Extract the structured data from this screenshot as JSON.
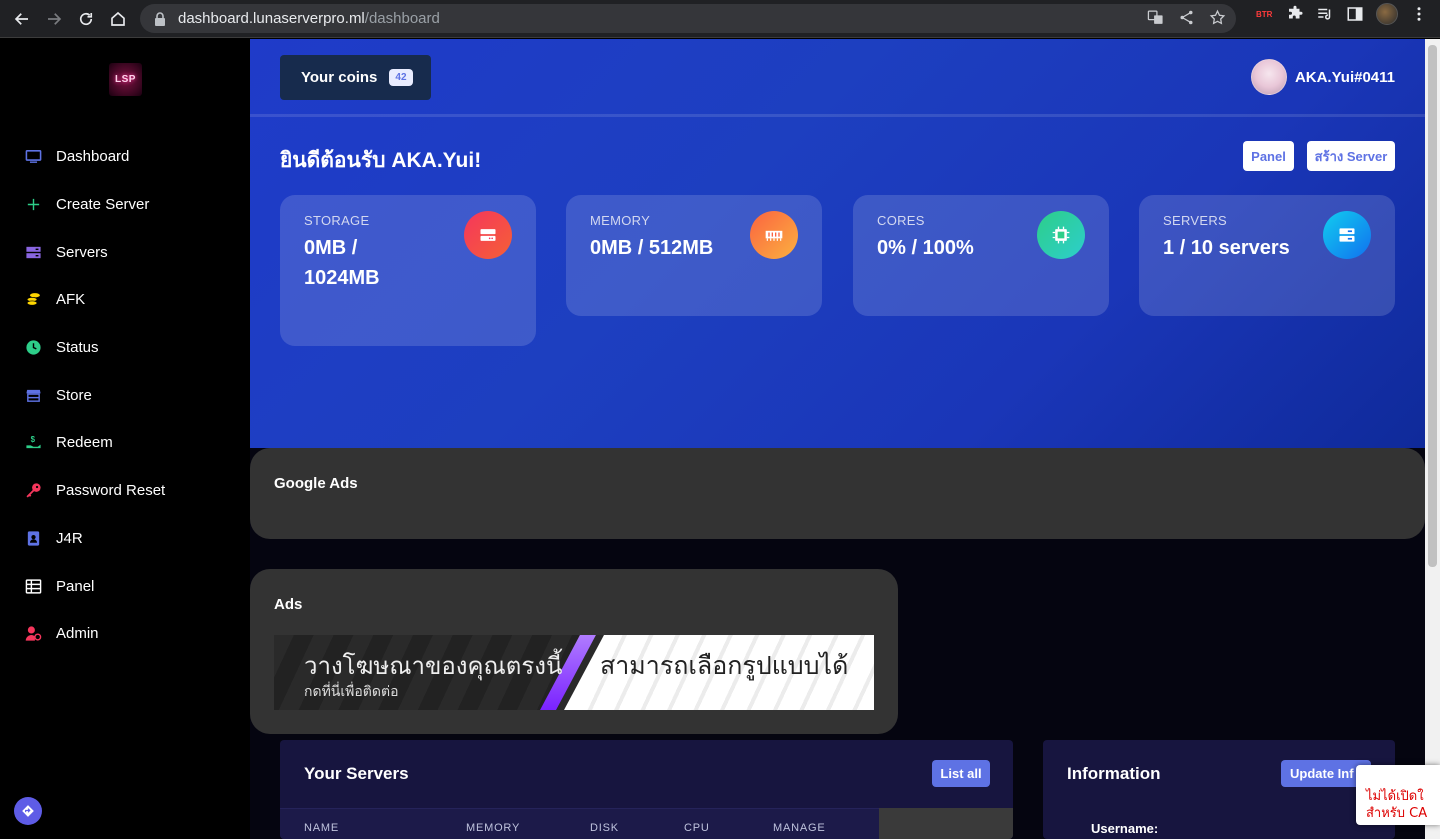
{
  "browser": {
    "url_host": "dashboard.lunaserverpro.ml",
    "url_path": "/dashboard",
    "ext_btr": "BTR"
  },
  "sidebar": {
    "logo": "LSP",
    "items": [
      {
        "label": "Dashboard",
        "icon": "monitor-icon",
        "color": "#5e72e4"
      },
      {
        "label": "Create Server",
        "icon": "plus-icon",
        "color": "#2dce89"
      },
      {
        "label": "Servers",
        "icon": "server-icon",
        "color": "#8965e0"
      },
      {
        "label": "AFK",
        "icon": "coins-icon",
        "color": "#ffd600"
      },
      {
        "label": "Status",
        "icon": "clock-icon",
        "color": "#2dce89"
      },
      {
        "label": "Store",
        "icon": "store-icon",
        "color": "#5e72e4"
      },
      {
        "label": "Redeem",
        "icon": "hand-dollar-icon",
        "color": "#2dce89"
      },
      {
        "label": "Password Reset",
        "icon": "key-icon",
        "color": "#f5365c"
      },
      {
        "label": "J4R",
        "icon": "contact-icon",
        "color": "#5e72e4"
      },
      {
        "label": "Panel",
        "icon": "table-icon",
        "color": "#ffffff"
      },
      {
        "label": "Admin",
        "icon": "user-cog-icon",
        "color": "#f5365c"
      }
    ]
  },
  "header": {
    "coins_label": "Your coins",
    "coins_value": "42",
    "username": "AKA.Yui#0411"
  },
  "hero": {
    "welcome": "ยินดีต้อนรับ AKA.Yui!",
    "panel_button": "Panel",
    "create_button": "สร้าง Server"
  },
  "stats": [
    {
      "label": "STORAGE",
      "value": "0MB / 1024MB",
      "icon": "hdd-icon",
      "color_from": "#f5365c",
      "color_to": "#f56036"
    },
    {
      "label": "MEMORY",
      "value": "0MB / 512MB",
      "icon": "memory-icon",
      "color_from": "#fb6340",
      "color_to": "#fbb140"
    },
    {
      "label": "CORES",
      "value": "0% / 100%",
      "icon": "cpu-icon",
      "color_from": "#2dce89",
      "color_to": "#2dcecc"
    },
    {
      "label": "SERVERS",
      "value": "1 / 10 servers",
      "icon": "server-icon",
      "color_from": "#11cdef",
      "color_to": "#1171ef"
    }
  ],
  "google_ads": {
    "title": "Google Ads"
  },
  "ads": {
    "title": "Ads",
    "banner_line1": "วางโฆษณาของคุณตรงนี้",
    "banner_line2": "กดที่นี่เพื่อติดต่อ",
    "banner_right": "สามารถเลือกรูปแบบได้"
  },
  "servers_panel": {
    "title": "Your Servers",
    "list_all": "List all",
    "columns": [
      "NAME",
      "MEMORY",
      "DISK",
      "CPU",
      "MANAGE"
    ]
  },
  "info_panel": {
    "title": "Information",
    "update_button": "Update Inf",
    "username_label": "Username:"
  },
  "toast": {
    "line1": "ไม่ได้เปิดใ",
    "line2": "สำหรับ CA"
  }
}
